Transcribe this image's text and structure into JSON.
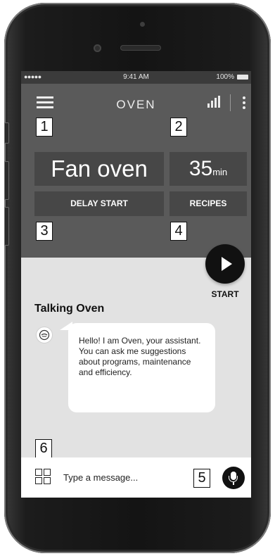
{
  "status_bar": {
    "signal": "●●●●● ",
    "time": "9:41 AM",
    "battery": "100%"
  },
  "header": {
    "title": "OVEN"
  },
  "callouts": [
    "1",
    "2",
    "3",
    "4",
    "5",
    "6"
  ],
  "oven": {
    "mode": "Fan oven",
    "time_value": "35",
    "time_unit": "min",
    "delay_start_label": "DELAY START",
    "recipes_label": "RECIPES",
    "start_label": "START"
  },
  "chat": {
    "title": "Talking Oven",
    "messages": [
      {
        "sender": "oven",
        "text": "Hello! I am Oven, your assistant. You can ask me suggestions about programs, maintenance and efficiency."
      }
    ]
  },
  "input": {
    "placeholder": "Type a message..."
  },
  "icons": {
    "menu": "hamburger-icon",
    "signal": "signal-bars-icon",
    "more": "kebab-icon",
    "start": "play-icon",
    "avatar": "oven-icon",
    "grid": "grid-icon",
    "mic": "microphone-icon"
  }
}
